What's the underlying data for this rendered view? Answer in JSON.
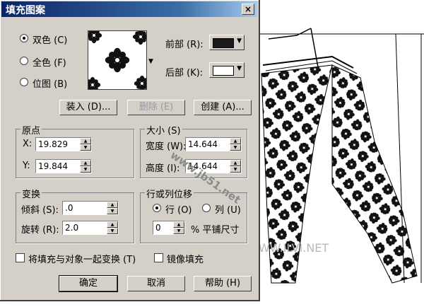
{
  "dialog": {
    "title": "填充图案",
    "close_glyph": "×",
    "mode_two_color": "双色 (C)",
    "mode_full_color": "全色 (F)",
    "mode_bitmap": "位图 (B)",
    "front_label": "前部 (R):",
    "back_label": "后部 (K):",
    "front_color": "#1a1a1a",
    "back_color": "#ffffff",
    "load_btn": "装入 (D)...",
    "delete_btn": "删除 (E)",
    "create_btn": "创建 (A)...",
    "origin_title": "原点",
    "origin_x_label": "X:",
    "origin_x_value": "19.829",
    "origin_y_label": "Y:",
    "origin_y_value": "19.844",
    "size_title": "大小 (S)",
    "width_label": "宽度 (W):",
    "width_value": "14.644",
    "height_label": "高度 (I):",
    "height_value": "14.644",
    "transform_title": "变换",
    "skew_label": "倾斜 (S):",
    "skew_value": ".0",
    "rotate_label": "旋转 (R):",
    "rotate_value": "2.0",
    "offset_title": "行或列位移",
    "row_label": "行 (O)",
    "col_label": "列 (U)",
    "offset_value": "0",
    "offset_suffix": "% 平铺尺寸",
    "check_transform": "将填充与对象一起变换 (T)",
    "check_mirror": "镜像填充",
    "ok_btn": "确定",
    "cancel_btn": "取消",
    "help_btn": "帮助 (H)"
  },
  "watermarks": {
    "diag": "www.jb51.net",
    "bottom": "WWW.ILVI.NET"
  }
}
